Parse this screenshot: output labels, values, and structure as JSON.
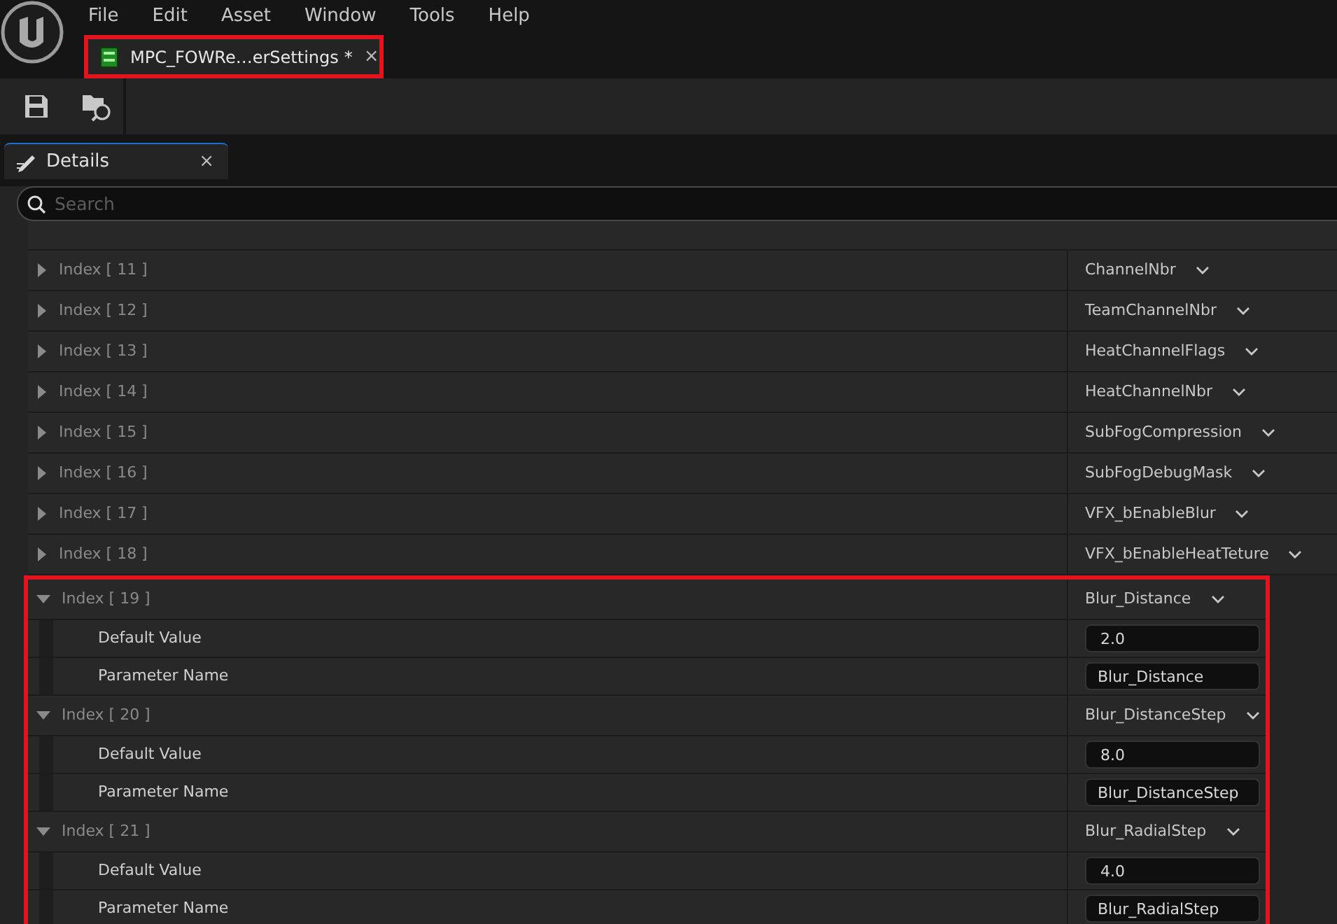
{
  "menu": [
    "File",
    "Edit",
    "Asset",
    "Window",
    "Tools",
    "Help"
  ],
  "document_tab": {
    "title": "MPC_FOWRe…erSettings",
    "modified_mark": "*",
    "close": "×",
    "highlighted": true
  },
  "details_tab": {
    "title": "Details",
    "close": "×"
  },
  "search": {
    "placeholder": "Search"
  },
  "rows": [
    {
      "label": "Index [ 11 ]",
      "value": "ChannelNbr",
      "expanded": false,
      "highlighted": false
    },
    {
      "label": "Index [ 12 ]",
      "value": "TeamChannelNbr",
      "expanded": false,
      "highlighted": false
    },
    {
      "label": "Index [ 13 ]",
      "value": "HeatChannelFlags",
      "expanded": false,
      "highlighted": false
    },
    {
      "label": "Index [ 14 ]",
      "value": "HeatChannelNbr",
      "expanded": false,
      "highlighted": false
    },
    {
      "label": "Index [ 15 ]",
      "value": "SubFogCompression",
      "expanded": false,
      "highlighted": false
    },
    {
      "label": "Index [ 16 ]",
      "value": "SubFogDebugMask",
      "expanded": false,
      "highlighted": false
    },
    {
      "label": "Index [ 17 ]",
      "value": "VFX_bEnableBlur",
      "expanded": false,
      "highlighted": false
    },
    {
      "label": "Index [ 18 ]",
      "value": "VFX_bEnableHeatTeture",
      "expanded": false,
      "highlighted": false
    },
    {
      "label": "Index [ 19 ]",
      "value": "Blur_Distance",
      "expanded": true,
      "highlighted": true,
      "children": [
        {
          "label": "Default Value",
          "kind": "number",
          "value": "2.0"
        },
        {
          "label": "Parameter Name",
          "kind": "text",
          "value": "Blur_Distance"
        }
      ]
    },
    {
      "label": "Index [ 20 ]",
      "value": "Blur_DistanceStep",
      "expanded": true,
      "highlighted": true,
      "children": [
        {
          "label": "Default Value",
          "kind": "number",
          "value": "8.0"
        },
        {
          "label": "Parameter Name",
          "kind": "text",
          "value": "Blur_DistanceStep"
        }
      ]
    },
    {
      "label": "Index [ 21 ]",
      "value": "Blur_RadialStep",
      "expanded": true,
      "highlighted": true,
      "children": [
        {
          "label": "Default Value",
          "kind": "number",
          "value": "4.0"
        },
        {
          "label": "Parameter Name",
          "kind": "text",
          "value": "Blur_RadialStep"
        }
      ]
    }
  ]
}
